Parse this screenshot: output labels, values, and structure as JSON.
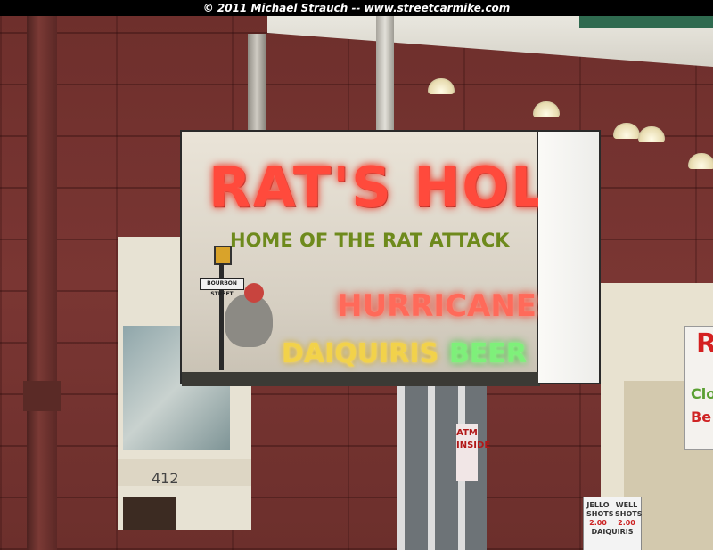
{
  "caption": {
    "copyright": "© 2011 Michael Strauch -- www.streetcarmike.com"
  },
  "sign": {
    "title": "RAT'S HOLE",
    "subtitle": "HOME OF THE RAT ATTACK",
    "line1": "HURRICANES",
    "line2_left": "DAIQUIRIS",
    "line2_right": "BEER",
    "street_plate": "BOURBON STREET"
  },
  "building": {
    "address_number": "412",
    "window_sign": "ATM INSIDE"
  },
  "right_sign": {
    "letter": "R",
    "line1": "Clo",
    "line2": "Be"
  },
  "menu_sign": {
    "left_label": "JELLO SHOTS",
    "left_price": "2.00",
    "right_label": "WELL SHOTS",
    "right_price": "2.00",
    "bottom_label": "DAIQUIRIS"
  },
  "colors": {
    "neon_red": "#ff4a3c",
    "neon_yellow": "#f2d24a",
    "neon_green": "#7ef07a",
    "neon_olive": "#6e8a1c",
    "brick": "#7a3633"
  }
}
